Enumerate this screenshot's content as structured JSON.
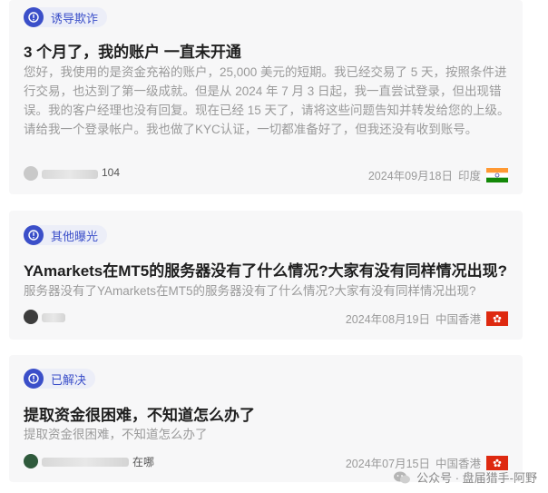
{
  "posts": [
    {
      "tag": "诱导欺诈",
      "title": "3 个月了，我的账户 一直未开通",
      "excerpt": "您好，我使用的是资金充裕的账户，25,000 美元的短期。我已经交易了 5 天，按照条件进行交易，也达到了第一级成就。但是从 2024 年 7 月 3 日起，我一直尝试登录，但出现错误。我的客户经理也没有回复。现在已经 15 天了，请将这些问题告知并转发给您的上级。请给我一个登录帐户。我也做了KYC认证，一切都准备好了，但我还没有收到账号。",
      "user": "104",
      "date": "2024年09月18日",
      "location": "印度",
      "flag": "india-flag"
    },
    {
      "tag": "其他曝光",
      "title": "YAmarkets在MT5的服务器没有了什么情况?大家有没有同样情况出现?",
      "excerpt": "服务器没有了YAmarkets在MT5的服务器没有了什么情况?大家有没有同样情况出现?",
      "user": "",
      "date": "2024年08月19日",
      "location": "中国香港",
      "flag": "hong-kong-flag"
    },
    {
      "tag": "已解决",
      "title": "提取资金很困难，不知道怎么办了",
      "excerpt": "提取资金很困难，不知道怎么办了",
      "user": "在哪",
      "date": "2024年07月15日",
      "location": "中国香港",
      "flag": "hong-kong-flag"
    }
  ],
  "watermark": "公众号 · 盘届猎手-阿野",
  "colors": {
    "accent": "#3b4fc9",
    "card": "#f7f7f8",
    "muted": "#9a9a9a"
  }
}
